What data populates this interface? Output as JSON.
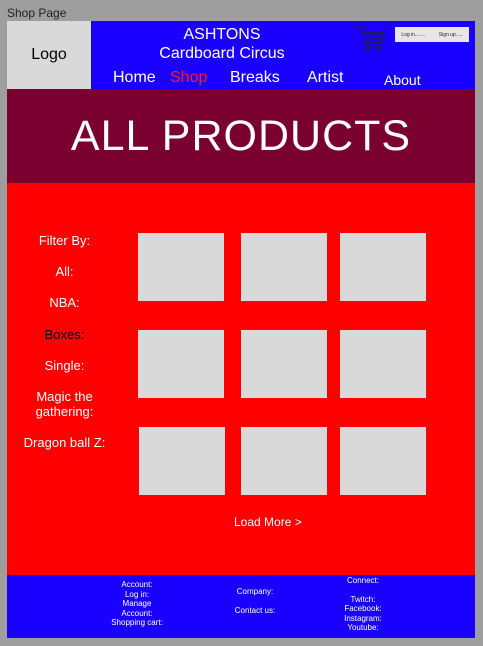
{
  "frame_label": "Shop Page",
  "header": {
    "logo": "Logo",
    "brand_line1": "ASHTONS",
    "brand_line2": "Cardboard Circus",
    "nav": [
      "Home",
      "Shop",
      "Breaks",
      "Artist",
      "About"
    ],
    "active_nav": "Shop",
    "auth": {
      "login": "Log in........",
      "signup": "Sign up....."
    },
    "cart_icon": "shopping-cart-icon"
  },
  "hero": {
    "title": "ALL PRODUCTS"
  },
  "filters": {
    "heading": "Filter By:",
    "items": [
      "All:",
      "NBA:",
      "Boxes:",
      "Single:",
      "Magic the gathering:",
      "Dragon ball Z:"
    ]
  },
  "products": {
    "rows": 3,
    "cols": 3
  },
  "load_more": "Load More >",
  "footer": {
    "account_col": [
      "Account:",
      "Log in:",
      "Manage",
      "Account:",
      "Shopping cart:"
    ],
    "company_col": [
      "Company:",
      "Contact us:"
    ],
    "connect_col": [
      "Connect:",
      "Twitch:",
      "Facebook:",
      "Instagram:",
      "Youtube:"
    ]
  },
  "colors": {
    "header": "#1a00ff",
    "hero": "#7a0030",
    "main": "#ff0000",
    "footer": "#1a00ff",
    "active_nav": "#ff1a1a"
  }
}
